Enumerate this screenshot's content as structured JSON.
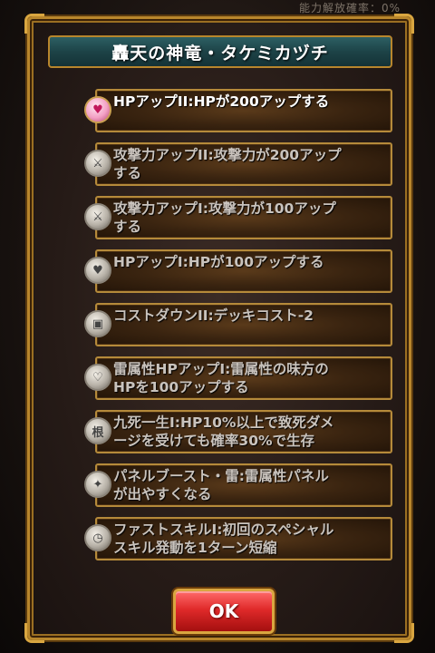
{
  "background": {
    "top_status": "能力解放確率：0%"
  },
  "dialog": {
    "title": "轟天の神竜・タケミカヅチ",
    "ok_label": "OK"
  },
  "skills": [
    {
      "text": "HPアップII:HPが200アップする",
      "icon": "heart-icon",
      "active": true
    },
    {
      "text": "攻撃力アップII:攻撃力が200アップ\nする",
      "icon": "sword-icon",
      "active": false
    },
    {
      "text": "攻撃力アップI:攻撃力が100アップ\nする",
      "icon": "sword-icon",
      "active": false
    },
    {
      "text": "HPアップI:HPが100アップする",
      "icon": "heart-icon",
      "active": false
    },
    {
      "text": "コストダウンII:デッキコスト-2",
      "icon": "cost-icon",
      "active": false
    },
    {
      "text": "雷属性HPアップI:雷属性の味方の\nHPを100アップする",
      "icon": "thunder-heart-icon",
      "active": false
    },
    {
      "text": "九死一生I:HP10%以上で致死ダメ\nージを受けても確率30%で生存",
      "icon": "endure-icon",
      "active": false
    },
    {
      "text": "パネルブースト・雷:雷属性パネル\nが出やすくなる",
      "icon": "panel-icon",
      "active": false
    },
    {
      "text": "ファストスキルI:初回のスペシャル\nスキル発動を1ターン短縮",
      "icon": "clock-icon",
      "active": false
    }
  ],
  "colors": {
    "frame_gold": "#b8862c",
    "title_teal": "#1d4347",
    "ok_red": "#e02a2a"
  }
}
